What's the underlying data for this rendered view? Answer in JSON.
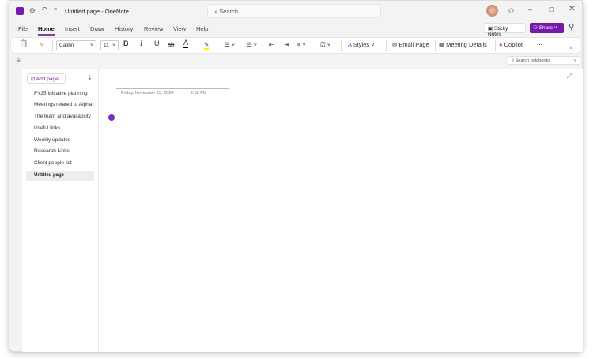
{
  "title": "Untitled page - OneNote",
  "search_placeholder": "Search",
  "tabs": [
    "File",
    "Home",
    "Insert",
    "Draw",
    "History",
    "Review",
    "View",
    "Help"
  ],
  "sticky_notes": "Sticky Notes",
  "share": "Share",
  "ribbon": {
    "font": "Calibri",
    "size": "11",
    "bold": "B",
    "italic": "I",
    "underline": "U",
    "strike": "ab",
    "font_color": "A",
    "styles": "Styles",
    "email_page": "Email Page",
    "meeting_details": "Meeting Details",
    "copilot": "Copilot",
    "more": "···"
  },
  "search_notebooks": "Search notebooks",
  "add_page": "Add page",
  "pages": [
    "FY25 Initiative planning",
    "Meetings related to Alpha",
    "The team and availability",
    "Useful links",
    "Weekly updates",
    "Research Links",
    "Client people list"
  ],
  "selected_page": "Untitled page",
  "page_date": "Friday, November 15, 2024",
  "page_time": "2:52 PM",
  "accent": "#7719aa"
}
